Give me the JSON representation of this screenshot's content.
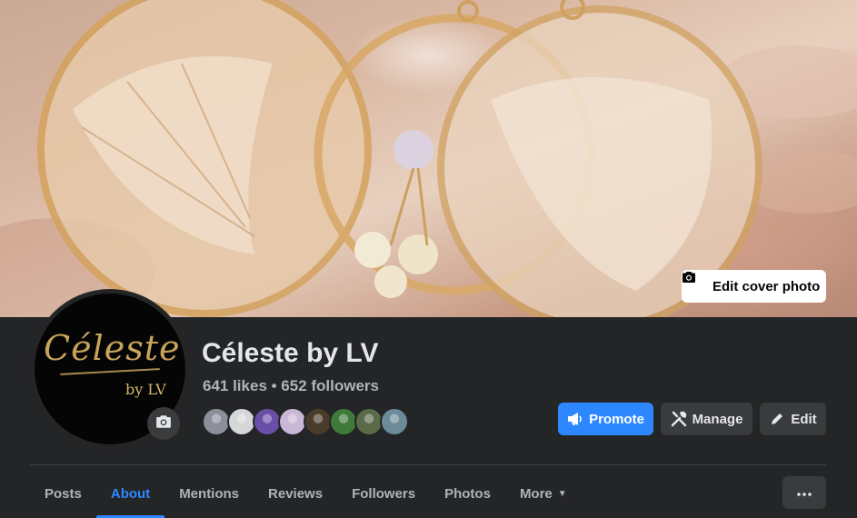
{
  "cover": {
    "edit_label": "Edit cover photo",
    "camera_icon": "camera-icon"
  },
  "profile": {
    "logo_text_main": "Céleste",
    "logo_text_sub": "by LV",
    "name": "Céleste by LV",
    "stats": "641 likes • 652 followers",
    "camera_icon": "camera-icon",
    "friend_avatar_colors": [
      "#8a8f9a",
      "#d6d7d9",
      "#6a4fa8",
      "#c9b7d8",
      "#4a3c2a",
      "#3f7a3a",
      "#5b6b4a",
      "#6d8a9a"
    ]
  },
  "actions": {
    "promote": {
      "label": "Promote",
      "icon": "megaphone-icon"
    },
    "manage": {
      "label": "Manage",
      "icon": "tools-icon"
    },
    "edit": {
      "label": "Edit",
      "icon": "pencil-icon"
    }
  },
  "tabs": [
    {
      "label": "Posts",
      "active": false
    },
    {
      "label": "About",
      "active": true
    },
    {
      "label": "Mentions",
      "active": false
    },
    {
      "label": "Reviews",
      "active": false
    },
    {
      "label": "Followers",
      "active": false
    },
    {
      "label": "Photos",
      "active": false
    },
    {
      "label": "More",
      "active": false
    }
  ],
  "more_menu_icon": "ellipsis-icon",
  "colors": {
    "accent": "#2d88ff",
    "background": "#242526",
    "button_secondary": "#3a3b3c"
  }
}
